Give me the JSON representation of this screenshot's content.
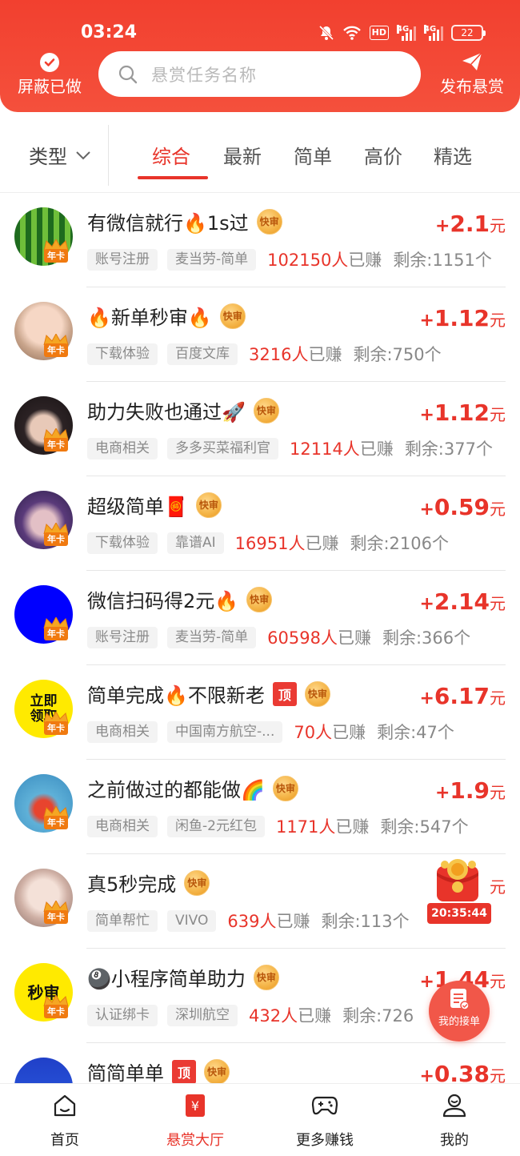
{
  "status_bar": {
    "time": "03:24",
    "hd_label": "HD",
    "signal1_label": "4G",
    "signal2_label": "4G",
    "battery": "22"
  },
  "header": {
    "hide_done_label": "屏蔽已做",
    "search_placeholder": "悬赏任务名称",
    "publish_label": "发布悬赏"
  },
  "filters": {
    "type_label": "类型",
    "tabs": [
      {
        "label": "综合",
        "active": true
      },
      {
        "label": "最新",
        "active": false
      },
      {
        "label": "简单",
        "active": false
      },
      {
        "label": "高价",
        "active": false
      },
      {
        "label": "精选",
        "active": false
      }
    ]
  },
  "badges": {
    "fast": "快审",
    "top": "顶",
    "vip": "年卡"
  },
  "tasks": [
    {
      "title": "有微信就行🔥1s过",
      "top": false,
      "tags": [
        "账号注册",
        "麦当劳-简单"
      ],
      "earned": "102150人",
      "earned_suffix": "已赚",
      "remaining": "剩余:1151个",
      "plus": "+",
      "amount": "2.1",
      "unit": "元",
      "avatar": "watermelon"
    },
    {
      "title": "🔥新单秒审🔥",
      "top": false,
      "tags": [
        "下载体验",
        "百度文库"
      ],
      "earned": "3216人",
      "earned_suffix": "已赚",
      "remaining": "剩余:750个",
      "plus": "+",
      "amount": "1.12",
      "unit": "元",
      "avatar": "kid"
    },
    {
      "title": "助力失败也通过🚀",
      "top": false,
      "tags": [
        "电商相关",
        "多多买菜福利官"
      ],
      "earned": "12114人",
      "earned_suffix": "已赚",
      "remaining": "剩余:377个",
      "plus": "+",
      "amount": "1.12",
      "unit": "元",
      "avatar": "girl-dark"
    },
    {
      "title": "超级简单🧧",
      "top": false,
      "tags": [
        "下载体验",
        "靠谱AI"
      ],
      "earned": "16951人",
      "earned_suffix": "已赚",
      "remaining": "剩余:2106个",
      "plus": "+",
      "amount": "0.59",
      "unit": "元",
      "avatar": "girl-purple"
    },
    {
      "title": "微信扫码得2元🔥",
      "top": false,
      "tags": [
        "账号注册",
        "麦当劳-简单"
      ],
      "earned": "60598人",
      "earned_suffix": "已赚",
      "remaining": "剩余:366个",
      "plus": "+",
      "amount": "2.14",
      "unit": "元",
      "avatar": "blue"
    },
    {
      "title": "简单完成🔥不限新老",
      "top": true,
      "tags": [
        "电商相关",
        "中国南方航空-..."
      ],
      "earned": "70人",
      "earned_suffix": "已赚",
      "remaining": "剩余:47个",
      "plus": "+",
      "amount": "6.17",
      "unit": "元",
      "avatar": "yellow-text",
      "avatar_text": "立即\n领取"
    },
    {
      "title": "之前做过的都能做🌈",
      "top": false,
      "tags": [
        "电商相关",
        "闲鱼-2元红包"
      ],
      "earned": "1171人",
      "earned_suffix": "已赚",
      "remaining": "剩余:547个",
      "plus": "+",
      "amount": "1.9",
      "unit": "元",
      "avatar": "cartoon"
    },
    {
      "title": "真5秒完成",
      "top": false,
      "tags": [
        "简单帮忙",
        "VIVO"
      ],
      "earned": "639人",
      "earned_suffix": "已赚",
      "remaining": "剩余:113个",
      "plus": "",
      "amount": "",
      "unit": "元",
      "avatar": "girl-light"
    },
    {
      "title": "🎱小程序简单助力",
      "top": false,
      "tags": [
        "认证绑卡",
        "深圳航空"
      ],
      "earned": "432人",
      "earned_suffix": "已赚",
      "remaining": "剩余:726",
      "plus": "+",
      "amount": "1.44",
      "unit": "元",
      "avatar": "yellow-text",
      "avatar_text": "秒审"
    },
    {
      "title": "简简单单",
      "top": true,
      "tags": [],
      "earned": "",
      "earned_suffix": "",
      "remaining": "",
      "plus": "+",
      "amount": "0.38",
      "unit": "元",
      "avatar": "blue-partial"
    }
  ],
  "floating": {
    "red_packet_timer": "20:35:44",
    "my_orders_label": "我的接单"
  },
  "bottom_nav": [
    {
      "label": "首页",
      "icon": "home-icon",
      "active": false
    },
    {
      "label": "悬赏大厅",
      "icon": "reward-hall-icon",
      "active": true
    },
    {
      "label": "更多赚钱",
      "icon": "gamepad-icon",
      "active": false
    },
    {
      "label": "我的",
      "icon": "profile-icon",
      "active": false
    }
  ],
  "colors": {
    "brand_red": "#e8342a",
    "header_bg": "#f2402f",
    "badge_gold": "#f5b64a",
    "vip_orange": "#f07a10"
  }
}
